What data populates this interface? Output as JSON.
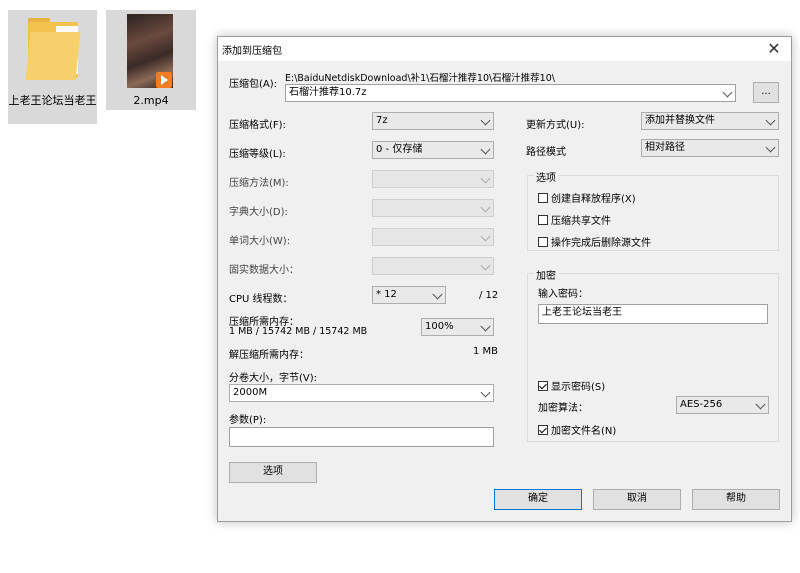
{
  "desktop": {
    "folder_label": "上老王论坛当老王",
    "video_label": "2.mp4"
  },
  "dialog": {
    "title": "添加到压缩包",
    "archive_label": "压缩包(A):",
    "archive_path": "E:\\BaiduNetdiskDownload\\补1\\石榴汁推荐10\\石榴汁推荐10\\",
    "archive_name": "石榴汁推荐10.7z",
    "browse_label": "...",
    "format_label": "压缩格式(F):",
    "format_value": "7z",
    "level_label": "压缩等级(L):",
    "level_value": "0 - 仅存储",
    "method_label": "压缩方法(M):",
    "dict_label": "字典大小(D):",
    "word_label": "单词大小(W):",
    "solid_label": "固实数据大小：",
    "cpu_label": "CPU 线程数：",
    "cpu_value": "* 12",
    "cpu_total": "/ 12",
    "mem_label": "压缩所需内存：",
    "mem_detail": "1 MB / 15742 MB / 15742 MB",
    "mem_value": "100%",
    "decomp_label": "解压缩所需内存：",
    "decomp_value": "1 MB",
    "volume_label": "分卷大小，字节(V):",
    "volume_value": "2000M",
    "params_label": "参数(P):",
    "params_value": "",
    "options_button": "选项",
    "update_label": "更新方式(U):",
    "update_value": "添加并替换文件",
    "path_label": "路径模式",
    "path_value": "相对路径",
    "options_group": {
      "title": "选项",
      "sfx": "创建自释放程序(X)",
      "shared": "压缩共享文件",
      "delete": "操作完成后删除源文件"
    },
    "encrypt_group": {
      "title": "加密",
      "password_label": "输入密码：",
      "password_value": "上老王论坛当老王",
      "show_password": "显示密码(S)",
      "algo_label": "加密算法：",
      "algo_value": "AES-256",
      "encrypt_names": "加密文件名(N)"
    },
    "ok_button": "确定",
    "cancel_button": "取消",
    "help_button": "帮助"
  }
}
